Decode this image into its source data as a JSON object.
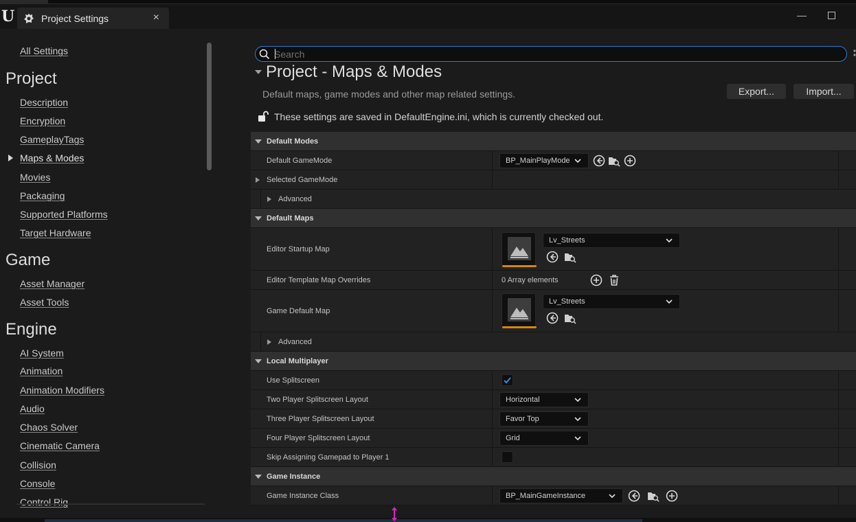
{
  "window": {
    "tab_title": "Project Settings",
    "tab_close": "×",
    "minimize": "—",
    "logo_letter": "U"
  },
  "sidebar": {
    "all_settings": "All Settings",
    "sections": [
      {
        "title": "Project",
        "items": [
          "Description",
          "Encryption",
          "GameplayTags",
          "Maps & Modes",
          "Movies",
          "Packaging",
          "Supported Platforms",
          "Target Hardware"
        ]
      },
      {
        "title": "Game",
        "items": [
          "Asset Manager",
          "Asset Tools"
        ]
      },
      {
        "title": "Engine",
        "items": [
          "AI System",
          "Animation",
          "Animation Modifiers",
          "Audio",
          "Chaos Solver",
          "Cinematic Camera",
          "Collision",
          "Console",
          "Control Rig"
        ]
      }
    ],
    "active_item": "Maps & Modes"
  },
  "search": {
    "placeholder": "Search",
    "value": ""
  },
  "page": {
    "title": "Project - Maps & Modes",
    "description": "Default maps, game modes and other map related settings.",
    "export_label": "Export...",
    "import_label": "Import...",
    "saved_note": "These settings are saved in DefaultEngine.ini, which is currently checked out."
  },
  "settings": {
    "default_modes": {
      "category": "Default Modes",
      "default_gamemode_label": "Default GameMode",
      "default_gamemode_value": "BP_MainPlayMode",
      "selected_gamemode_label": "Selected GameMode",
      "advanced_label": "Advanced"
    },
    "default_maps": {
      "category": "Default Maps",
      "editor_startup_label": "Editor Startup Map",
      "editor_startup_value": "Lv_Streets",
      "template_overrides_label": "Editor Template Map Overrides",
      "template_overrides_value": "0 Array elements",
      "game_default_label": "Game Default Map",
      "game_default_value": "Lv_Streets",
      "advanced_label": "Advanced"
    },
    "local_multiplayer": {
      "category": "Local Multiplayer",
      "use_splitscreen_label": "Use Splitscreen",
      "use_splitscreen_checked": true,
      "two_player_label": "Two Player Splitscreen Layout",
      "two_player_value": "Horizontal",
      "three_player_label": "Three Player Splitscreen Layout",
      "three_player_value": "Favor Top",
      "four_player_label": "Four Player Splitscreen Layout",
      "four_player_value": "Grid",
      "skip_gamepad_label": "Skip Assigning Gamepad to Player 1",
      "skip_gamepad_checked": false
    },
    "game_instance": {
      "category": "Game Instance",
      "class_label": "Game Instance Class",
      "class_value": "BP_MainGameInstance"
    }
  },
  "colors": {
    "accent_blue": "#2c7bd6",
    "check_blue": "#2f8be6",
    "thumb_orange": "#d6860f",
    "background": "#1b1b1b"
  }
}
